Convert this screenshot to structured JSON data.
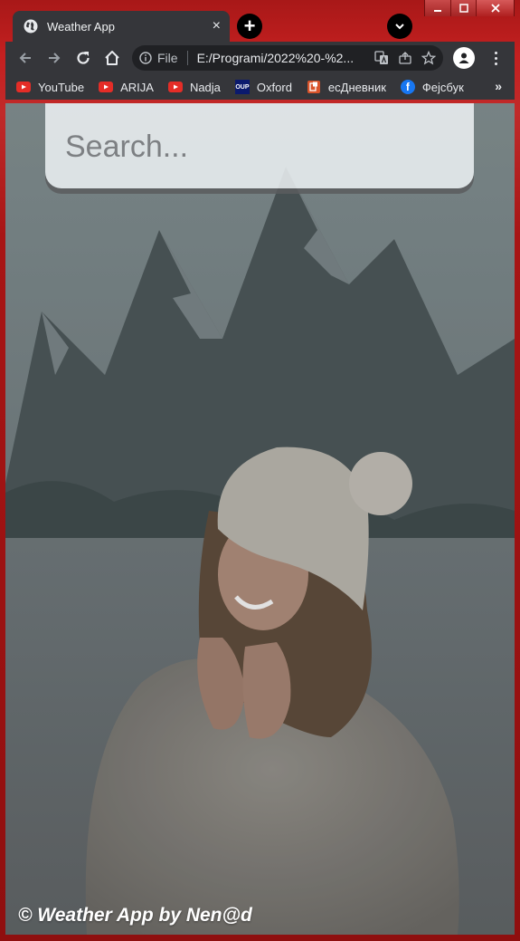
{
  "browser": {
    "tab": {
      "title": "Weather App",
      "close_glyph": "×"
    },
    "new_tab_glyph": "+",
    "address": {
      "scheme_label": "File",
      "url": "E:/Programi/2022%20-%2..."
    },
    "bookmarks": [
      {
        "label": "YouTube",
        "icon": "youtube-icon"
      },
      {
        "label": "ARIJA",
        "icon": "youtube-icon"
      },
      {
        "label": "Nadja",
        "icon": "youtube-icon"
      },
      {
        "label": "Oxford",
        "icon": "oup-icon",
        "icon_text": "OUP"
      },
      {
        "label": "есДневник",
        "icon": "esdnevnik-icon"
      },
      {
        "label": "Фејсбук",
        "icon": "facebook-icon",
        "icon_text": "f"
      }
    ],
    "bookmarks_more": "»"
  },
  "page": {
    "search": {
      "placeholder": "Search..."
    },
    "footer": "© Weather App by Nen@d"
  },
  "colors": {
    "window_frame": "#a81818",
    "chrome_dark": "#35363a",
    "omnibox": "#202124",
    "youtube_red": "#e52d27",
    "facebook_blue": "#1877f2",
    "oup_navy": "#0b1a6e"
  }
}
